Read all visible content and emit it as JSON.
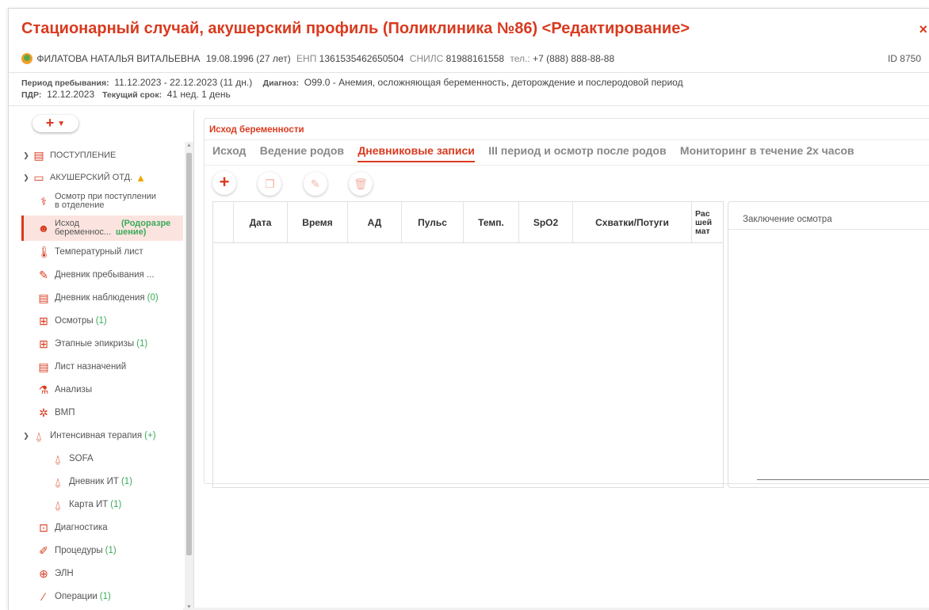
{
  "title": "Стационарный случай, акушерский профиль (Поликлиника №86) <Редактирование>",
  "close_label": "×",
  "patient": {
    "name": "ФИЛАТОВА НАТАЛЬЯ ВИТАЛЬЕВНА",
    "dob": "19.08.1996 (27 лет)",
    "enp_label": "ЕНП",
    "enp": "1361535462650504",
    "snils_label": "СНИЛС",
    "snils": "81988161558",
    "phone_label": "тел.:",
    "phone": "+7 (888) 888-88-88",
    "id": "ID 8750"
  },
  "info": {
    "stay_label": "Период пребывания:",
    "stay": "11.12.2023 - 22.12.2023 (11 дн.)",
    "diag_label": "Диагноз:",
    "diag": "O99.0 - Анемия, осложняющая беременность, деторождение и послеродовой период",
    "pdr_label": "ПДР:",
    "pdr": "12.12.2023",
    "term_label": "Текущий срок:",
    "term": "41 нед. 1 день"
  },
  "sidebar": {
    "add_label": "+",
    "items": [
      {
        "label": "ПОСТУПЛЕНИЕ",
        "icon": "clipboard-icon"
      },
      {
        "label": "АКУШЕРСКИЙ ОТД.",
        "icon": "bed-icon"
      },
      {
        "label": "Осмотр при поступлении в отделение",
        "line1": "Осмотр при поступлении",
        "line2": "в отделение",
        "icon": "exam-icon"
      },
      {
        "line1": "Исход",
        "line2": "беременнос...",
        "tag1": "(Родоразре",
        "tag2": "шение)",
        "icon": "baby-icon"
      },
      {
        "label": "Температурный лист",
        "icon": "thermometer-icon"
      },
      {
        "label": "Дневник пребывания ...",
        "icon": "pencil-icon"
      },
      {
        "label": "Дневник наблюдения",
        "count": "(0)",
        "icon": "document-icon"
      },
      {
        "label": "Осмотры",
        "count": "(1)",
        "icon": "medical-clipboard-icon"
      },
      {
        "label": "Этапные эпикризы",
        "count": "(1)",
        "icon": "plus-document-icon"
      },
      {
        "label": "Лист назначений",
        "icon": "clipboard-icon"
      },
      {
        "label": "Анализы",
        "icon": "flask-icon"
      },
      {
        "label": "ВМП",
        "icon": "dna-icon"
      },
      {
        "label": "Интенсивная терапия",
        "count": "(+)",
        "icon": "alarm-icon"
      },
      {
        "label": "SOFA",
        "icon": "alarm-icon"
      },
      {
        "label": "Дневник ИТ",
        "count": "(1)",
        "icon": "alarm-icon"
      },
      {
        "label": "Карта ИТ",
        "count": "(1)",
        "icon": "alarm-icon"
      },
      {
        "label": "Диагностика",
        "icon": "cardiogram-icon"
      },
      {
        "label": "Процедуры",
        "count": "(1)",
        "icon": "syringe-icon"
      },
      {
        "label": "ЭЛН",
        "icon": "sick-leave-icon"
      },
      {
        "label": "Операции",
        "count": "(1)",
        "icon": "scalpel-icon"
      }
    ]
  },
  "main": {
    "title": "Исход беременности",
    "tabs": [
      "Исход",
      "Ведение родов",
      "Дневниковые записи",
      "III период и осмотр после родов",
      "Мониторинг в течение 2х часов"
    ],
    "active_tab": "Дневниковые записи",
    "columns": [
      "Дата",
      "Время",
      "АД",
      "Пульс",
      "Темп.",
      "SpO2",
      "Схватки/Потуги"
    ],
    "col_partial": [
      "Рас",
      "шей",
      "мат"
    ],
    "conclusion_title": "Заключение осмотра"
  },
  "colors": {
    "accent": "#d93a1e",
    "count_green": "#3aaa5a",
    "warning": "#f0a500",
    "active_bg": "#fbe4df"
  }
}
